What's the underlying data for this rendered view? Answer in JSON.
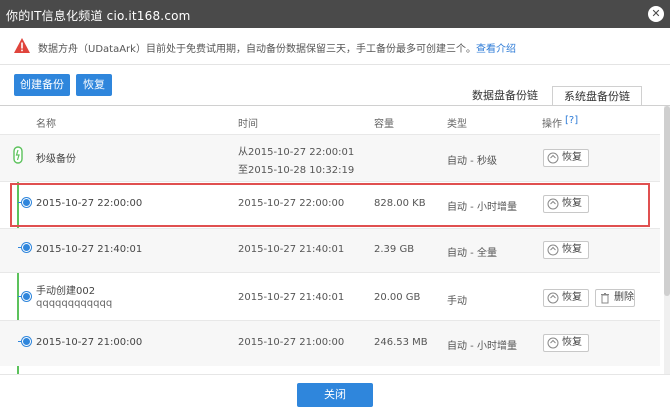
{
  "watermark": "你的IT信息化频道 cio.it168.com",
  "notice": {
    "text": "数据方舟（UDataArk）目前处于免费试用期，自动备份数据保留三天，手工备份最多可创建三个。",
    "link": "查看介绍"
  },
  "toolbar": {
    "create_label": "创建备份",
    "restore_label": "恢复"
  },
  "tabs": [
    {
      "label": "数据盘备份链",
      "active": false
    },
    {
      "label": "系统盘备份链",
      "active": true
    }
  ],
  "columns": {
    "name": "名称",
    "time": "时间",
    "size": "容量",
    "type": "类型",
    "ops": "操作",
    "help": "[?]"
  },
  "rows": [
    {
      "name": "秒级备份",
      "time_from": "从2015-10-27 22:00:01",
      "time_to": "至2015-10-28 10:32:19",
      "size": "",
      "type": "自动 - 秒级",
      "restore": "恢复"
    },
    {
      "name": "2015-10-27 22:00:00",
      "time": "2015-10-27 22:00:00",
      "size": "828.00 KB",
      "type": "自动 - 小时增量",
      "restore": "恢复"
    },
    {
      "name": "2015-10-27 21:40:01",
      "time": "2015-10-27 21:40:01",
      "size": "2.39 GB",
      "type": "自动 - 全量",
      "restore": "恢复"
    },
    {
      "name": "手动创建002",
      "sub": "qqqqqqqqqqqq",
      "time": "2015-10-27 21:40:01",
      "size": "20.00 GB",
      "type": "手动",
      "restore": "恢复",
      "delete": "删除"
    },
    {
      "name": "2015-10-27 21:00:00",
      "time": "2015-10-27 21:00:00",
      "size": "246.53 MB",
      "type": "自动 - 小时增量",
      "restore": "恢复"
    }
  ],
  "footer": {
    "close_label": "关闭"
  },
  "colors": {
    "accent": "#2f86dc",
    "highlight": "#e05050",
    "timeline": "#5cc25c",
    "warning": "#e0443c"
  }
}
